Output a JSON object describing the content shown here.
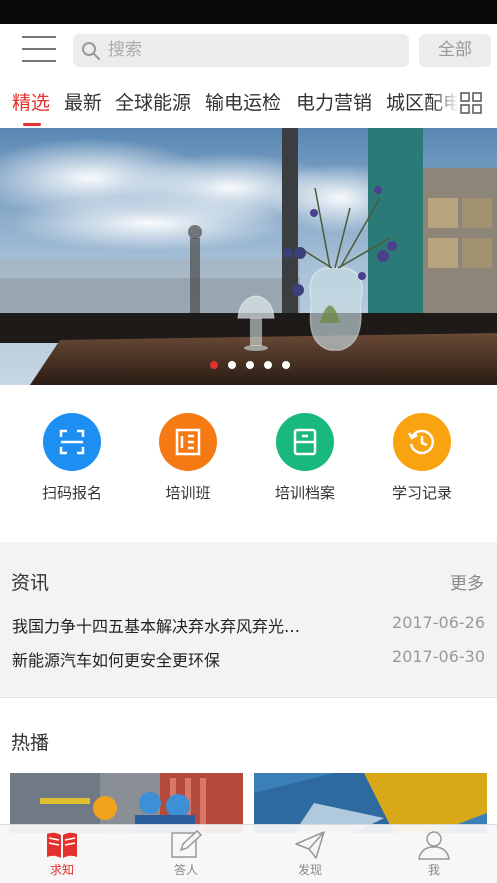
{
  "search": {
    "placeholder": "搜索",
    "all_label": "全部"
  },
  "tabs": [
    {
      "label": "精选",
      "active": true
    },
    {
      "label": "最新"
    },
    {
      "label": "全球能源"
    },
    {
      "label": "输电运检"
    },
    {
      "label": "电力营销"
    },
    {
      "label": "城区配电"
    }
  ],
  "banner": {
    "slides": 5,
    "current": 1
  },
  "quick_actions": [
    {
      "label": "扫码报名",
      "icon": "scan-icon",
      "color": "#1e8ff2"
    },
    {
      "label": "培训班",
      "icon": "training-class-icon",
      "color": "#f67a14"
    },
    {
      "label": "培训档案",
      "icon": "archive-icon",
      "color": "#19b97d"
    },
    {
      "label": "学习记录",
      "icon": "history-icon",
      "color": "#f8a30f"
    }
  ],
  "news": {
    "title": "资讯",
    "more": "更多",
    "items": [
      {
        "title": "我国力争十四五基本解决弃水弃风弃光…",
        "date": "2017-06-26"
      },
      {
        "title": "新能源汽车如何更安全更环保",
        "date": "2017-06-30"
      }
    ]
  },
  "hot": {
    "title": "热播"
  },
  "tabbar": [
    {
      "label": "求知",
      "icon": "book-icon",
      "active": true
    },
    {
      "label": "答人",
      "icon": "edit-icon"
    },
    {
      "label": "发现",
      "icon": "paper-plane-icon"
    },
    {
      "label": "我",
      "icon": "person-icon"
    }
  ],
  "colors": {
    "accent": "#e3312d",
    "section_bg": "#f3f3f5"
  }
}
